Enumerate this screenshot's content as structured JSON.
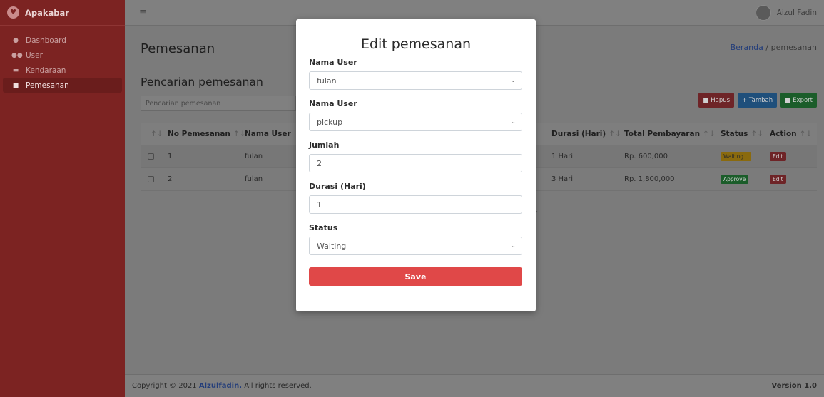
{
  "sidebar": {
    "brand": "Apakabar",
    "items": [
      {
        "label": "Dashboard",
        "icon": "palette-icon"
      },
      {
        "label": "User",
        "icon": "users-icon"
      },
      {
        "label": "Kendaraan",
        "icon": "car-icon"
      },
      {
        "label": "Pemesanan",
        "icon": "book-icon"
      }
    ]
  },
  "topbar": {
    "user_name": "Aizul Fadin"
  },
  "page": {
    "title": "Pemesanan",
    "breadcrumb_home": "Beranda",
    "breadcrumb_sep": "/",
    "breadcrumb_current": "pemesanan",
    "subtitle": "Pencarian pemesanan",
    "search_placeholder": "Pencarian pemesanan"
  },
  "actions": {
    "hapus": "Hapus",
    "tambah": "+ Tambah",
    "export": "Export"
  },
  "table": {
    "headers": [
      "No Pemesanan",
      "Nama User",
      "Durasi (Hari)",
      "Total Pembayaran",
      "Status",
      "Action"
    ],
    "rows": [
      {
        "no": "1",
        "user": "fulan",
        "durasi": "1 Hari",
        "total": "Rp. 600,000",
        "status": "Waiting...",
        "action": "Edit"
      },
      {
        "no": "2",
        "user": "fulan",
        "durasi": "3 Hari",
        "total": "Rp. 1,800,000",
        "status": "Approve",
        "action": "Edit"
      }
    ]
  },
  "footer": {
    "copyright_prefix": "Copyright © 2021",
    "author": "Alzulfadin.",
    "copyright_suffix": "All rights reserved.",
    "version": "Version 1.0"
  },
  "modal": {
    "title": "Edit pemesanan",
    "fields": [
      {
        "label": "Nama User",
        "value": "fulan"
      },
      {
        "label": "Nama User",
        "value": "pickup"
      },
      {
        "label": "Jumlah",
        "value": "2"
      },
      {
        "label": "Durasi (Hari)",
        "value": "1"
      },
      {
        "label": "Status",
        "value": "Waiting"
      }
    ],
    "save_label": "Save"
  },
  "colors": {
    "sidebar": "#7c2322",
    "save_button": "#e04848",
    "link": "#233d7a"
  }
}
